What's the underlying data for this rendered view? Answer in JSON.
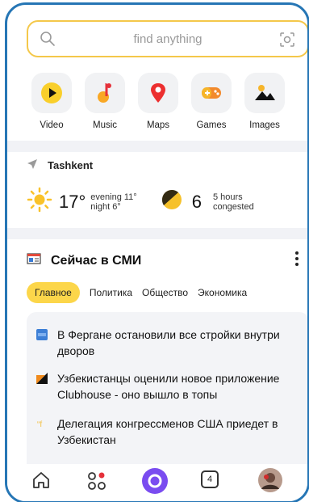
{
  "search": {
    "placeholder": "find anything"
  },
  "apps": [
    {
      "label": "Video",
      "icon": "play-icon"
    },
    {
      "label": "Music",
      "icon": "music-note-icon"
    },
    {
      "label": "Maps",
      "icon": "map-pin-icon"
    },
    {
      "label": "Games",
      "icon": "gamepad-icon"
    },
    {
      "label": "Images",
      "icon": "image-icon"
    }
  ],
  "weather": {
    "city": "Tashkent",
    "temp": "17°",
    "evening": "evening 11°",
    "night": "night 6°",
    "traffic_score": "6",
    "traffic_time": "5 hours",
    "traffic_status": "congested"
  },
  "news": {
    "title": "Сейчас в СМИ",
    "tabs": [
      "Главное",
      "Политика",
      "Общество",
      "Экономика"
    ],
    "active_tab": "Главное",
    "items": [
      {
        "text": "В Фергане остановили все стройки внутри дворов",
        "source_color": "#3d7fd6"
      },
      {
        "text": "Узбекистанцы оценили новое приложение Clubhouse - оно вышло в топы",
        "source_color": "#f08a1c"
      },
      {
        "text": "Делегация конгрессменов США приедет в Узбекистан",
        "source_color": "#f3c24a"
      }
    ]
  },
  "bottom_nav": {
    "tabs_count": "4"
  },
  "colors": {
    "accent": "#fcd64a",
    "frame": "#2676b5",
    "alice": "#7a4cf0"
  }
}
